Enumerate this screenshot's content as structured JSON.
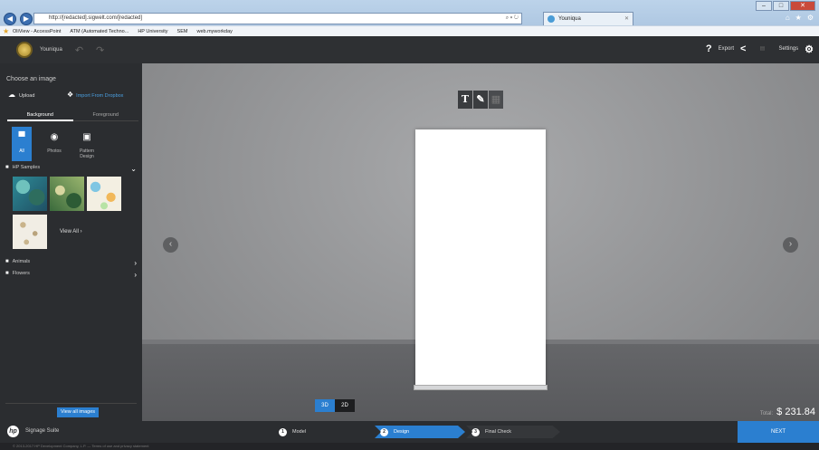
{
  "browser": {
    "url": "http://[redacted].sigwelt.com/[redacted]",
    "tab_title": "Youniqua",
    "favorites": [
      "OliView - AccessPoint",
      "ATM (Automated Techno...",
      "HP University",
      "SEM",
      "web.myworkday"
    ],
    "window_controls": [
      "–",
      "□",
      "✕"
    ],
    "tools": [
      "⌂",
      "★",
      "⚙"
    ]
  },
  "app": {
    "name": "Youniqua",
    "undo_icon": "undo-icon",
    "redo_icon": "redo-icon",
    "help": "?",
    "export_label": "Export",
    "settings_label": "Settings"
  },
  "left": {
    "choose_label": "Choose an image",
    "upload_label": "Upload",
    "dropbox_label": "Import From Dropbox",
    "tabs": [
      {
        "label": "Background",
        "active": true
      },
      {
        "label": "Foreground",
        "active": false
      }
    ],
    "types": [
      {
        "label": "All",
        "icon": "folder-icon",
        "glyph": "▀",
        "active": true
      },
      {
        "label": "Photos",
        "icon": "photo-icon",
        "glyph": "◉",
        "active": false
      },
      {
        "label": "Pattern Design",
        "icon": "pattern-icon",
        "glyph": "▣",
        "active": false
      }
    ],
    "folders": [
      {
        "label": "HP Samples",
        "arrow": "⌄"
      },
      {
        "label": "Animals",
        "arrow": "›"
      },
      {
        "label": "Flowers",
        "arrow": "›"
      }
    ],
    "view_all": "View All",
    "view_all_images": "View all images"
  },
  "canvas": {
    "tools": [
      "T",
      "✎",
      "▦"
    ],
    "dims": [
      {
        "label": "3D",
        "active": true
      },
      {
        "label": "2D",
        "active": false
      }
    ],
    "total_label": "Total:",
    "total_value": "$ 231.84"
  },
  "bottom": {
    "product": "Signage Suite",
    "steps": [
      {
        "num": "1",
        "label": "Model"
      },
      {
        "num": "2",
        "label": "Design"
      },
      {
        "num": "3",
        "label": "Final Check"
      }
    ],
    "next": "NEXT",
    "footer": "© 2013-2017 HP Development Company, L.P. — Terms of use and privacy statement"
  },
  "colors": {
    "accent": "#2b7fd0",
    "panel": "#2b2d30",
    "canvas": "#9a9b9d"
  }
}
